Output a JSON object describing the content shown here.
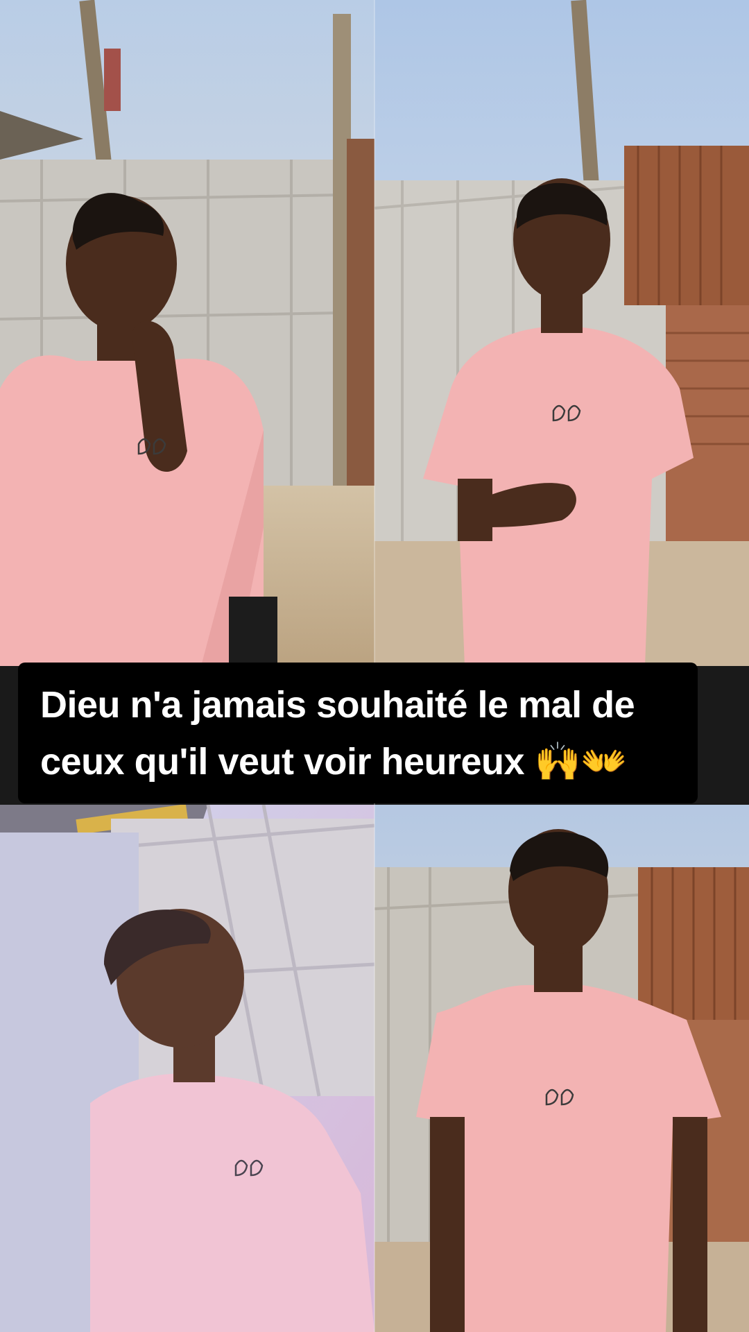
{
  "caption": {
    "line1": "Dieu n'a jamais souhaité le mal de",
    "line2": "ceux qu'il veut voir heureux 🙌👐"
  },
  "photos": [
    {
      "name": "photo-top-left",
      "subject": "young man in pink t-shirt, hand on chin"
    },
    {
      "name": "photo-top-right",
      "subject": "young man in pink t-shirt, hand raised"
    },
    {
      "name": "photo-bottom-left",
      "subject": "young man in pink t-shirt, looking right"
    },
    {
      "name": "photo-bottom-right",
      "subject": "young man in pink t-shirt, standing"
    }
  ],
  "colors": {
    "sky": "#c9d8ea",
    "fence": "#c9c6c0",
    "rust": "#9a5a3a",
    "shirt": "#f3b3b3",
    "skin": "#4a2c1d",
    "ground": "#c9b49a",
    "caption_bg": "#000000",
    "caption_text": "#ffffff"
  }
}
